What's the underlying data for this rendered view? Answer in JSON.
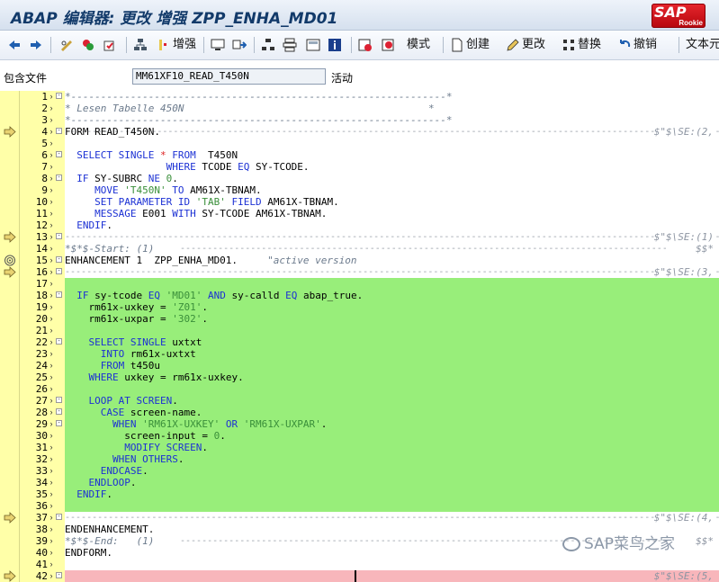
{
  "window": {
    "title": "ABAP 编辑器: 更改 增强 ZPP_ENHA_MD01",
    "logo": {
      "text": "SAP",
      "sub": "Rookie"
    }
  },
  "toolbar": {
    "enhance_label": "增强",
    "mode_label": "模式",
    "create_label": "创建",
    "change_label": "更改",
    "replace_label": "替换",
    "undo_label": "撤销",
    "text_label": "文本元"
  },
  "header": {
    "include_label": "包含文件",
    "include_value": "MM61XF10_READ_T450N",
    "status": "活动"
  },
  "colors": {
    "enhancement_bg": "#98ee7a",
    "pink_bg": "#f8b6bb",
    "gutter": "#ffffa8",
    "keyword": "#1c31d4",
    "string": "#3a8f3a"
  },
  "editor": {
    "lines": [
      {
        "n": "1",
        "box": "-",
        "hasDash": true,
        "dashText": "*---------------------------------------------------------------*"
      },
      {
        "n": "2",
        "code": "* Lesen Tabelle 450N                                         *",
        "cm": true
      },
      {
        "n": "3",
        "hasDash": true,
        "dashText": "*---------------------------------------------------------------*"
      },
      {
        "n": "4",
        "box": "-",
        "code": "FORM READ_T450N.",
        "mark": "arrow",
        "dashed": true
      },
      {
        "n": "5",
        "code": ""
      },
      {
        "n": "6",
        "box": "-",
        "code": "  SELECT SINGLE * FROM  T450N"
      },
      {
        "n": "7",
        "code": "                 WHERE TCODE EQ SY-TCODE."
      },
      {
        "n": "8",
        "box": "-",
        "code": "  IF SY-SUBRC NE 0."
      },
      {
        "n": "9",
        "code": "     MOVE 'T450N' TO AM61X-TBNAM."
      },
      {
        "n": "10",
        "code": "     SET PARAMETER ID 'TAB' FIELD AM61X-TBNAM."
      },
      {
        "n": "11",
        "code": "     MESSAGE E001 WITH SY-TCODE AM61X-TBNAM."
      },
      {
        "n": "12",
        "code": "  ENDIF."
      },
      {
        "n": "13",
        "box": "-",
        "mark": "arrow",
        "dashed": true
      },
      {
        "n": "14",
        "code": "*$*$-Start: (1)",
        "cm": true
      },
      {
        "n": "15",
        "box": "-",
        "mark": "spiral",
        "code": "ENHANCEMENT 1  ZPP_ENHA_MD01.     \"active version"
      },
      {
        "n": "16",
        "box": "-",
        "mark": "arrow",
        "dashed": true
      },
      {
        "n": "17",
        "g": true
      },
      {
        "n": "18",
        "box": "-",
        "g": true,
        "code": "  IF sy-tcode EQ 'MD01' AND sy-calld EQ abap_true."
      },
      {
        "n": "19",
        "g": true,
        "code": "    rm61x-uxkey = 'Z01'."
      },
      {
        "n": "20",
        "g": true,
        "code": "    rm61x-uxpar = '302'."
      },
      {
        "n": "21",
        "g": true
      },
      {
        "n": "22",
        "box": "-",
        "g": true,
        "code": "    SELECT SINGLE uxtxt"
      },
      {
        "n": "23",
        "g": true,
        "code": "      INTO rm61x-uxtxt"
      },
      {
        "n": "24",
        "g": true,
        "code": "      FROM t450u"
      },
      {
        "n": "25",
        "g": true,
        "code": "    WHERE uxkey = rm61x-uxkey."
      },
      {
        "n": "26",
        "g": true
      },
      {
        "n": "27",
        "box": "-",
        "g": true,
        "code": "    LOOP AT SCREEN."
      },
      {
        "n": "28",
        "box": "-",
        "g": true,
        "code": "      CASE screen-name."
      },
      {
        "n": "29",
        "box": "-",
        "g": true,
        "code": "        WHEN 'RM61X-UXKEY' OR 'RM61X-UXPAR'."
      },
      {
        "n": "30",
        "g": true,
        "code": "          screen-input = 0."
      },
      {
        "n": "31",
        "g": true,
        "code": "          MODIFY SCREEN."
      },
      {
        "n": "32",
        "g": true,
        "code": "        WHEN OTHERS."
      },
      {
        "n": "33",
        "g": true,
        "code": "      ENDCASE."
      },
      {
        "n": "34",
        "g": true,
        "code": "    ENDLOOP."
      },
      {
        "n": "35",
        "g": true,
        "code": "  ENDIF."
      },
      {
        "n": "36",
        "g": true
      },
      {
        "n": "37",
        "box": "-",
        "mark": "arrow",
        "dashed": true
      },
      {
        "n": "38",
        "code": "ENDENHANCEMENT."
      },
      {
        "n": "39",
        "code": "*$*$-End:   (1)",
        "cm": true
      },
      {
        "n": "40",
        "code": "ENDFORM."
      },
      {
        "n": "41",
        "code": ""
      },
      {
        "n": "42",
        "box": "-",
        "mark": "arrow",
        "p": true
      }
    ],
    "right_notes": {
      "4": "$\"$\\SE:(2,",
      "13": "$\"$\\SE:(1)",
      "14": "$$*",
      "16": "$\"$\\SE:(3,",
      "37": "$\"$\\SE:(4,",
      "39": "$$*",
      "42": "$\"$\\SE:(5,"
    }
  },
  "watermark": "SAP菜鸟之家"
}
